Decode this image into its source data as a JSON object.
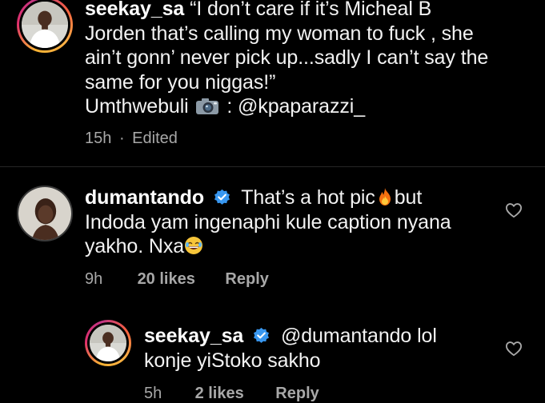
{
  "post_caption": {
    "username": "seekay_sa",
    "lines": [
      "“I don’t care if it’s Micheal B",
      "Jorden that’s calling my woman to fuck , she",
      "ain’t gonn’ never pick up...sadly I can’t say the",
      "same for you niggas!”"
    ],
    "credit_prefix": "Umthwebuli",
    "credit_icon": "camera-emoji",
    "credit_suffix": ": @kpaparazzi_",
    "time": "15h",
    "separator": "·",
    "edited": "Edited"
  },
  "comments": [
    {
      "username": "dumantando",
      "verified": true,
      "line1_text": "That’s a hot pic",
      "line1_emoji": "fire-emoji",
      "line1_after": "but",
      "line2": "Indoda yam ingenaphi kule caption nyana",
      "line3_text": "yakho. Nxa",
      "line3_emoji": "laughing-emoji",
      "time": "9h",
      "likes": "20 likes",
      "reply": "Reply"
    },
    {
      "username": "seekay_sa",
      "verified": true,
      "line1_text": "@dumantando lol",
      "line2": "konje yiStoko sakho",
      "time": "5h",
      "likes": "2 likes",
      "reply": "Reply"
    }
  ],
  "colors": {
    "background": "#000000",
    "text": "#f2f2f2",
    "meta": "#a8a8a8",
    "verified": "#3897f0"
  }
}
